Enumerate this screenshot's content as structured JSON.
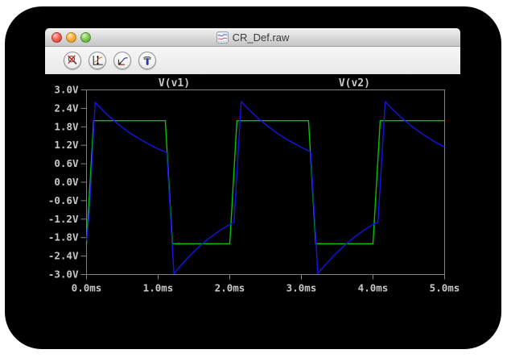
{
  "window": {
    "title": "CR_Def.raw"
  },
  "titlebar": {
    "buttons": [
      {
        "name": "close"
      },
      {
        "name": "minimize"
      },
      {
        "name": "zoom"
      }
    ]
  },
  "toolbar": {
    "buttons": [
      {
        "name": "zoom-undo",
        "icon": "magnifier-with-red-x-icon"
      },
      {
        "name": "autorange",
        "icon": "axes-autorange-icon"
      },
      {
        "name": "plot-settings",
        "icon": "plot-cursor-icon"
      },
      {
        "name": "control-panel",
        "icon": "hammer-icon"
      }
    ]
  },
  "chart_data": {
    "type": "line",
    "title": "",
    "xlabel": "",
    "ylabel": "",
    "background": "#000000",
    "axis_color": "#828282",
    "label_color": "#c8c8c8",
    "grid": false,
    "legend_position": "top",
    "x": {
      "unit": "ms",
      "min": 0,
      "max": 5,
      "ticks": [
        0,
        1,
        2,
        3,
        4,
        5
      ],
      "tick_labels": [
        "0.0ms",
        "1.0ms",
        "2.0ms",
        "3.0ms",
        "4.0ms",
        "5.0ms"
      ]
    },
    "y": {
      "unit": "V",
      "min": -3,
      "max": 3,
      "ticks": [
        3.0,
        2.4,
        1.8,
        1.2,
        0.6,
        0.0,
        -0.6,
        -1.2,
        -1.8,
        -2.4,
        -3.0
      ],
      "tick_labels": [
        "3.0V",
        "2.4V",
        "1.8V",
        "1.2V",
        "0.6V",
        "0.0V",
        "-0.6V",
        "-1.2V",
        "-1.8V",
        "-2.4V",
        "-3.0V"
      ]
    },
    "series": [
      {
        "name": "V(v1)",
        "color": "#00c400",
        "legend_x_frac": 0.245,
        "points": [
          [
            0.0,
            -2.0
          ],
          [
            0.1,
            2.0
          ],
          [
            1.1,
            2.0
          ],
          [
            1.2,
            -2.0
          ],
          [
            2.0,
            -2.0
          ],
          [
            2.1,
            2.0
          ],
          [
            3.1,
            2.0
          ],
          [
            3.2,
            -2.0
          ],
          [
            4.0,
            -2.0
          ],
          [
            4.1,
            2.0
          ],
          [
            5.0,
            2.0
          ]
        ]
      },
      {
        "name": "V(v2)",
        "color": "#1414e8",
        "legend_x_frac": 0.748,
        "points": [
          [
            0.0,
            -1.9
          ],
          [
            0.04,
            -1.0
          ],
          [
            0.12,
            2.6
          ],
          [
            0.2,
            2.4
          ],
          [
            0.3,
            2.17
          ],
          [
            0.45,
            1.87
          ],
          [
            0.6,
            1.61
          ],
          [
            0.75,
            1.39
          ],
          [
            0.9,
            1.2
          ],
          [
            1.02,
            1.06
          ],
          [
            1.12,
            0.97
          ],
          [
            1.22,
            -2.97
          ],
          [
            1.3,
            -2.75
          ],
          [
            1.42,
            -2.44
          ],
          [
            1.55,
            -2.14
          ],
          [
            1.7,
            -1.84
          ],
          [
            1.85,
            -1.59
          ],
          [
            1.97,
            -1.41
          ],
          [
            2.06,
            -1.3
          ],
          [
            2.16,
            2.62
          ],
          [
            2.25,
            2.4
          ],
          [
            2.38,
            2.11
          ],
          [
            2.52,
            1.84
          ],
          [
            2.67,
            1.58
          ],
          [
            2.82,
            1.36
          ],
          [
            2.97,
            1.17
          ],
          [
            3.13,
            0.98
          ],
          [
            3.23,
            -2.97
          ],
          [
            3.32,
            -2.72
          ],
          [
            3.45,
            -2.39
          ],
          [
            3.58,
            -2.1
          ],
          [
            3.73,
            -1.8
          ],
          [
            3.88,
            -1.55
          ],
          [
            4.0,
            -1.37
          ],
          [
            4.07,
            -1.3
          ],
          [
            4.17,
            2.62
          ],
          [
            4.27,
            2.38
          ],
          [
            4.4,
            2.09
          ],
          [
            4.55,
            1.8
          ],
          [
            4.7,
            1.55
          ],
          [
            4.85,
            1.33
          ],
          [
            5.0,
            1.14
          ]
        ]
      }
    ]
  }
}
